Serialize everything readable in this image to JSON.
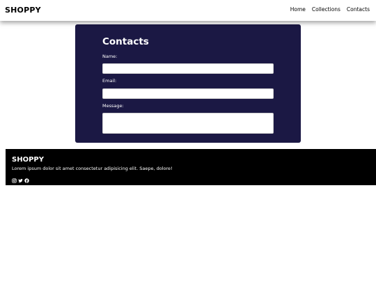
{
  "navbar": {
    "brand": "SHOPPY",
    "links": [
      "Home",
      "Collections",
      "Contacts"
    ]
  },
  "contact": {
    "title": "Contacts",
    "name_label": "Name:",
    "email_label": "Email:",
    "message_label": "Message:"
  },
  "footer": {
    "brand": "SHOPPY",
    "text": "Lorem ipsum dolor sit amet consectetur adipisicing elit. Saepe, dolore!",
    "social_icons": [
      "instagram-icon",
      "twitter-icon",
      "facebook-icon"
    ]
  },
  "colors": {
    "card_background": "#1b1844",
    "footer_background": "#000000",
    "page_background": "#ffffff"
  }
}
